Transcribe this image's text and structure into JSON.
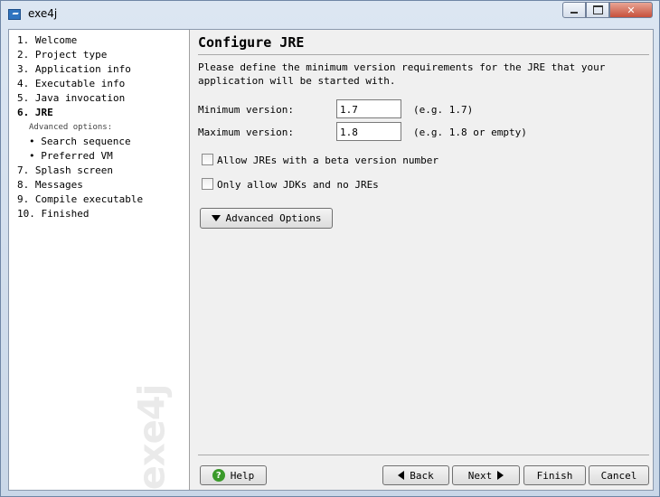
{
  "window": {
    "title": "exe4j",
    "close_glyph": "✕"
  },
  "sidebar": {
    "steps": [
      {
        "label": "1.  Welcome"
      },
      {
        "label": "2.  Project type"
      },
      {
        "label": "3.  Application info"
      },
      {
        "label": "4.  Executable info"
      },
      {
        "label": "5.  Java invocation"
      },
      {
        "label": "6.  JRE"
      },
      {
        "label": "Advanced options:"
      },
      {
        "label": "• Search sequence"
      },
      {
        "label": "• Preferred VM"
      },
      {
        "label": "7.  Splash screen"
      },
      {
        "label": "8.  Messages"
      },
      {
        "label": "9.  Compile executable"
      },
      {
        "label": "10.  Finished"
      }
    ],
    "active_step": "6.  JRE",
    "watermark": "exe4j"
  },
  "main": {
    "heading": "Configure JRE",
    "description": "Please define the minimum version requirements for the JRE that your application will be started with.",
    "min_version": {
      "label": "Minimum version:",
      "value": "1.7",
      "hint": "(e.g. 1.7)"
    },
    "max_version": {
      "label": "Maximum version:",
      "value": "1.8",
      "hint": "(e.g. 1.8 or empty)"
    },
    "allow_beta": {
      "label": "Allow JREs with a beta version number",
      "checked": false
    },
    "only_jdks": {
      "label": "Only allow JDKs and no JREs",
      "checked": false
    },
    "advanced_button": "Advanced Options"
  },
  "footer": {
    "help": "Help",
    "back": "Back",
    "next": "Next",
    "finish": "Finish",
    "cancel": "Cancel"
  },
  "colors": {
    "help_icon": "#3a9a2a",
    "close_button": "#c7503b"
  },
  "icons": [
    "app-icon",
    "minimize-icon",
    "maximize-icon",
    "close-icon",
    "triangle-down-icon",
    "help-icon",
    "back-arrow-icon",
    "next-arrow-icon"
  ]
}
